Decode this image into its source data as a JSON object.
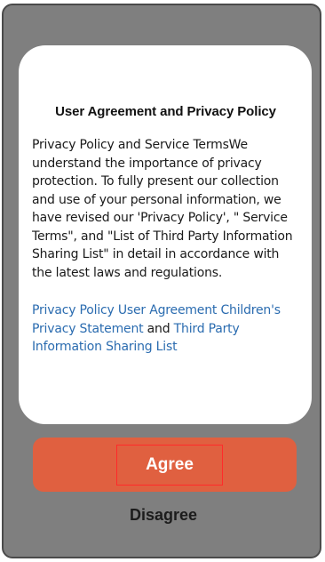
{
  "dialog": {
    "title": "User Agreement and Privacy Policy",
    "body": "Privacy Policy and Service TermsWe understand the importance of privacy protection. To fully present our collection and use of your personal information, we have revised our 'Privacy Policy', \" Service Terms\", and \"List of Third Party Information Sharing List\" in detail in accordance with the latest laws and regulations.",
    "links": {
      "privacy_policy": "Privacy Policy",
      "user_agreement": "User  Agreement",
      "childrens_privacy": "Children's Privacy Statement",
      "and_text": " and ",
      "third_party": "Third Party Information Sharing List"
    }
  },
  "actions": {
    "agree_label": "Agree",
    "disagree_label": "Disagree"
  },
  "colors": {
    "overlay": "#7f7f7f",
    "agree_button": "#e06040",
    "link": "#2b6cb0",
    "highlight_border": "#ff2a2a"
  }
}
